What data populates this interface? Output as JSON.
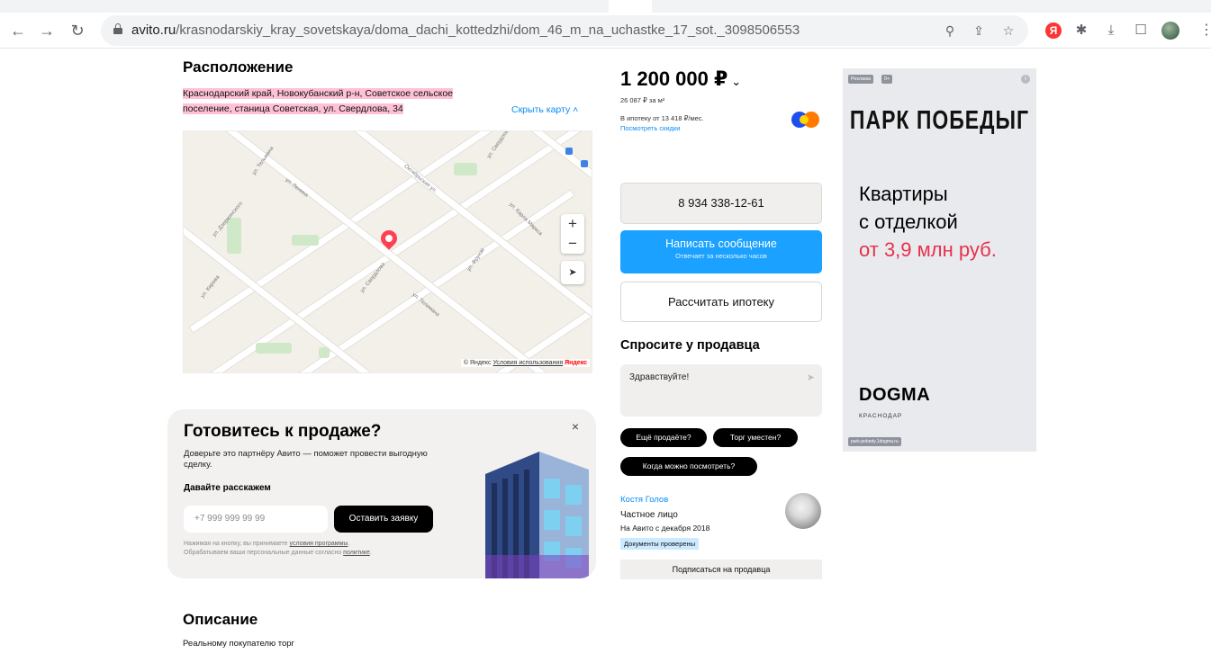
{
  "browser": {
    "url_host": "avito.ru",
    "url_path": "/krasnodarskiy_kray_sovetskaya/doma_dachi_kottedzhi/dom_46_m_na_uchastke_17_sot._3098506553",
    "icons": [
      "back-icon",
      "forward-icon",
      "reload-icon",
      "lock-icon",
      "zoom-icon",
      "share-icon",
      "bookmark-star-icon",
      "yandex-extension-icon",
      "extensions-puzzle-icon",
      "download-icon",
      "side-panel-icon",
      "profile-avatar",
      "menu-kebab-icon"
    ],
    "yandex_letter": "Я"
  },
  "location": {
    "title": "Расположение",
    "address_line1": "Краснодарский край, Новокубанский р-н, Советское сельское",
    "address_line2": "поселение, станица Советская, ул. Свердлова, 34",
    "hide_map": "Скрыть карту",
    "map": {
      "streets": [
        "ул. Свердлова",
        "Октябрьская ул.",
        "ул. Дзержинского",
        "ул. Ленина",
        "ул. Карла Маркса",
        "ул. Фрунзе",
        "ул. Кирова",
        "ул. Свердлова",
        "ул. Тельмана",
        "ул. Телиманa"
      ],
      "attribution_prefix": "© Яндекс",
      "attribution_link": "Условия использования",
      "attribution_logo": "Яндекс",
      "zoom_in": "+",
      "zoom_out": "−",
      "locate": "➤"
    }
  },
  "promo": {
    "title": "Готовитесь к продаже?",
    "description": "Доверьте это партнёру Авито — поможет провести выгодную сделку.",
    "subtitle": "Давайте расскажем",
    "phone_placeholder": "+7 999 999 99 99",
    "submit": "Оставить заявку",
    "legal_1": "Нажимая на кнопку, вы принимаете ",
    "legal_link1": "условия программы",
    "legal_2": ".",
    "legal_3": "Обрабатываем ваши персональные данные согласно ",
    "legal_link2": "политике",
    "legal_4": ".",
    "close": "×"
  },
  "description": {
    "title": "Описание",
    "text": "Реальному покупателю торг"
  },
  "price": {
    "value": "1 200 000 ₽",
    "chevron": "⌄",
    "per_m2": "26 087 ₽ за м²",
    "mortgage_text": "В ипотеку от 13 418 ₽/мес.",
    "discount_link": "Посмотреть скидки"
  },
  "actions": {
    "phone": "8 934 338-12-61",
    "message": "Написать сообщение",
    "message_sub": "Отвечает за несколько часов",
    "mortgage": "Рассчитать ипотеку"
  },
  "ask": {
    "title": "Спросите у продавца",
    "message": "Здравствуйте!",
    "send_icon": "➤",
    "chips": [
      "Ещё продаёте?",
      "Торг уместен?",
      "Когда можно посмотреть?"
    ]
  },
  "seller": {
    "name": "Костя Голов",
    "type": "Частное лицо",
    "since": "На Авито с декабря 2018",
    "badge": "Документы проверены",
    "subscribe": "Подписаться на продавца"
  },
  "ad": {
    "tag": "Реклама",
    "tag2": "0+",
    "info": "i",
    "brand": "ПАРК ПОБЕДЫГ",
    "headline1": "Квартиры",
    "headline2": "с отделкой",
    "headline3": "от 3,9 млн руб.",
    "developer": "DOGMA",
    "city": "КРАСНОДАР",
    "site": "park-pobedy.1dogma.ru",
    "accent_color": "#e6314b"
  },
  "colors": {
    "link": "#0a8df5",
    "primary_button": "#1ba1ff",
    "address_highlight": "#ffc1d6",
    "pin": "#ff4053"
  }
}
